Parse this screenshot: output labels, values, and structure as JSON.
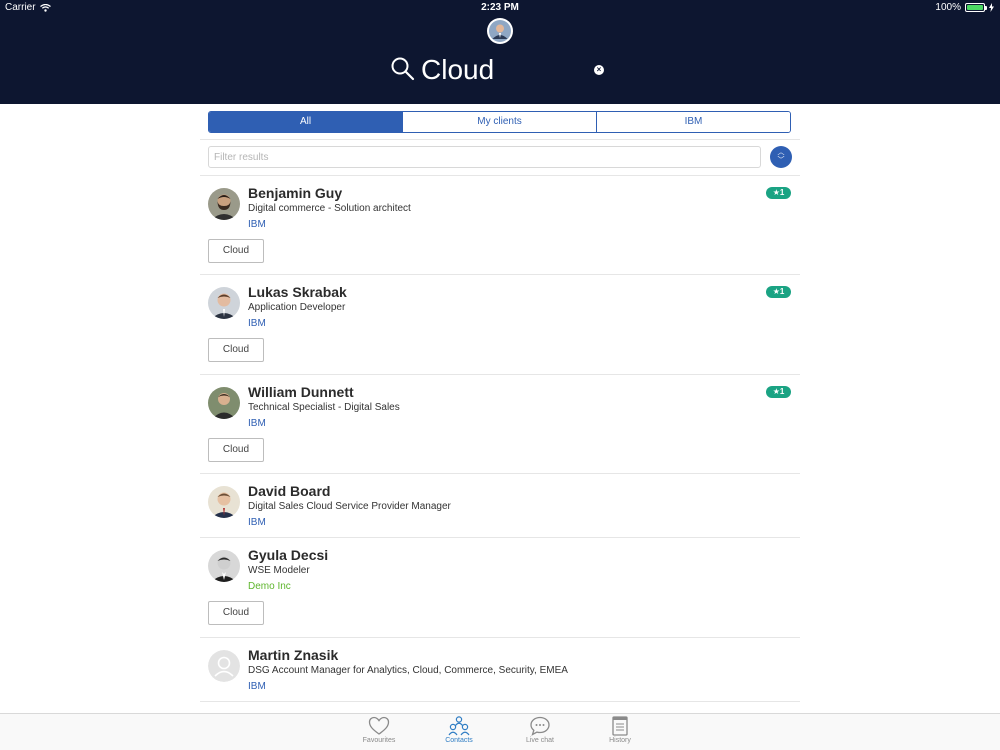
{
  "status_bar": {
    "carrier": "Carrier",
    "time": "2:23 PM",
    "battery": "100%"
  },
  "search": {
    "query": "Cloud"
  },
  "segments": [
    {
      "label": "All",
      "active": true
    },
    {
      "label": "My clients",
      "active": false
    },
    {
      "label": "IBM",
      "active": false
    }
  ],
  "filter": {
    "placeholder": "Filter results"
  },
  "contacts": [
    {
      "name": "Benjamin Guy",
      "title": "Digital commerce - Solution architect",
      "company": "IBM",
      "company_color": "#2f5fb3",
      "badge": "★1",
      "tag": "Cloud"
    },
    {
      "name": "Lukas Skrabak",
      "title": "Application Developer",
      "company": "IBM",
      "company_color": "#2f5fb3",
      "badge": "★1",
      "tag": "Cloud"
    },
    {
      "name": "William Dunnett",
      "title": "Technical Specialist - Digital Sales",
      "company": "IBM",
      "company_color": "#2f5fb3",
      "badge": "★1",
      "tag": "Cloud"
    },
    {
      "name": "David Board",
      "title": "Digital Sales Cloud Service Provider Manager",
      "company": "IBM",
      "company_color": "#2f5fb3"
    },
    {
      "name": "Gyula Decsi",
      "title": "WSE Modeler",
      "company": "Demo Inc",
      "company_color": "#5fb62e",
      "tag": "Cloud"
    },
    {
      "name": "Martin Znasik",
      "title": "DSG Account Manager for Analytics, Cloud, Commerce, Security, EMEA",
      "company": "IBM",
      "company_color": "#2f5fb3"
    }
  ],
  "tabs": [
    {
      "label": "Favourites",
      "icon": "heart-icon",
      "active": false
    },
    {
      "label": "Contacts",
      "icon": "contacts-icon",
      "active": true
    },
    {
      "label": "Live chat",
      "icon": "chat-bubble-icon",
      "active": false
    },
    {
      "label": "History",
      "icon": "history-document-icon",
      "active": false
    }
  ],
  "colors": {
    "header_bg": "#0d1630",
    "accent": "#2f5fb3",
    "badge": "#1aa383",
    "demo_company": "#5fb62e",
    "active_tab": "#2f7dc4"
  }
}
